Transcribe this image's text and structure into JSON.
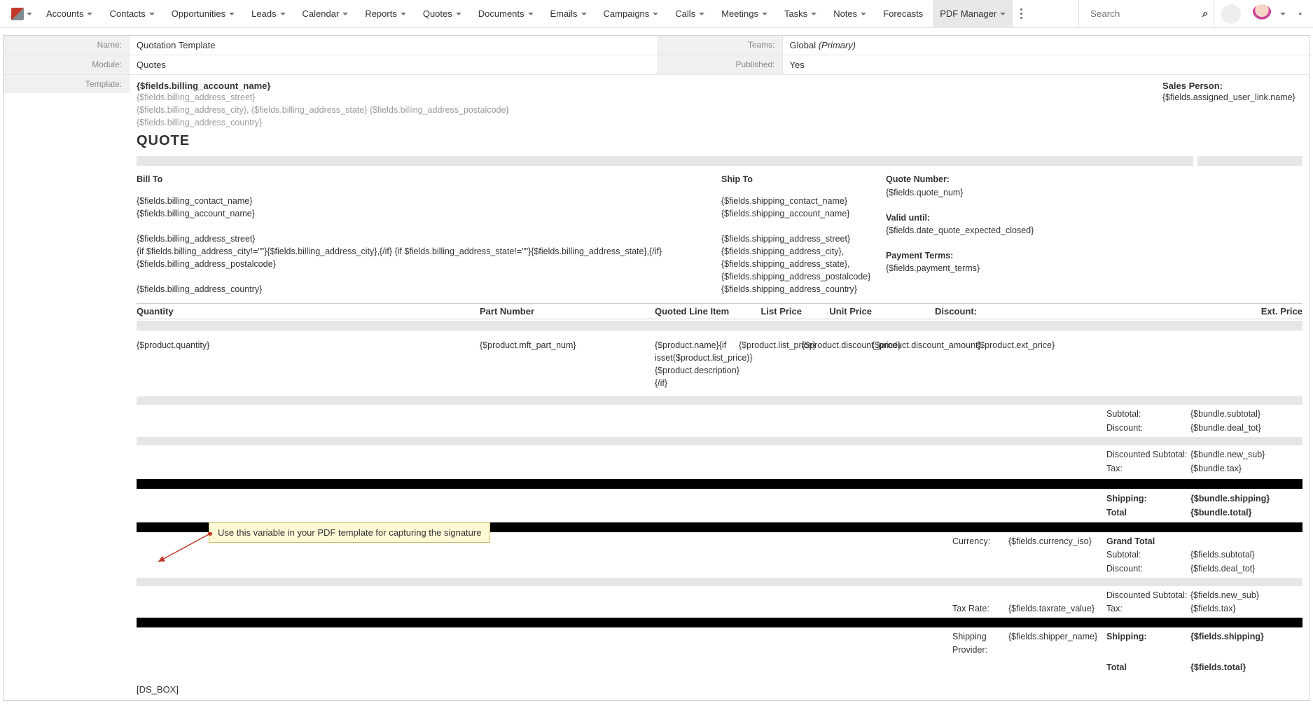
{
  "nav": {
    "items": [
      "Accounts",
      "Contacts",
      "Opportunities",
      "Leads",
      "Calendar",
      "Reports",
      "Quotes",
      "Documents",
      "Emails",
      "Campaigns",
      "Calls",
      "Meetings",
      "Tasks",
      "Notes",
      "Forecasts",
      "PDF Manager"
    ],
    "search_placeholder": "Search"
  },
  "record": {
    "labels": {
      "name": "Name:",
      "teams": "Teams:",
      "module": "Module:",
      "published": "Published:",
      "template": "Template:"
    },
    "name": "Quotation Template",
    "teams": "Global (Primary)",
    "teams_prefix": "Global ",
    "teams_suffix": "(Primary)",
    "module": "Quotes",
    "published": "Yes"
  },
  "template": {
    "billing_account": "{$fields.billing_account_name}",
    "addr_street": "{$fields.billing_address_street}",
    "addr_line2": "{$fields.billing_address_city}, {$fields.billing_address_state} {$fields.billing_address_postalcode}",
    "addr_country": "{$fields.billing_address_country}",
    "quote_heading": "QUOTE",
    "sales_person_label": "Sales Person:",
    "sales_person_value": "{$fields.assigned_user_link.name}",
    "bill_to": {
      "heading": "Bill To",
      "contact": "{$fields.billing_contact_name}",
      "account": "{$fields.billing_account_name}",
      "street": "{$fields.billing_address_street}",
      "citystate": "{if $fields.billing_address_city!=\"\"}{$fields.billing_address_city},{/if} {if $fields.billing_address_state!=\"\"}{$fields.billing_address_state},{/if} {$fields.billing_address_postalcode}",
      "country": "{$fields.billing_address_country}"
    },
    "ship_to": {
      "heading": "Ship To",
      "contact": "{$fields.shipping_contact_name}",
      "account": "{$fields.shipping_account_name}",
      "street": "{$fields.shipping_address_street}",
      "city": "{$fields.shipping_address_city},",
      "state": "{$fields.shipping_address_state},",
      "postal": "{$fields.shipping_address_postalcode}",
      "country": "{$fields.shipping_address_country}"
    },
    "right": {
      "qn_label": "Quote Number:",
      "qn_value": "{$fields.quote_num}",
      "valid_label": "Valid until:",
      "valid_value": "{$fields.date_quote_expected_closed}",
      "terms_label": "Payment Terms:",
      "terms_value": "{$fields.payment_terms}"
    },
    "table": {
      "headers": {
        "qty": "Quantity",
        "part": "Part Number",
        "qli": "Quoted Line Item",
        "list": "List Price",
        "unit": "Unit Price",
        "disc": "Discount:",
        "ext": "Ext. Price"
      },
      "row": {
        "qty": "{$product.quantity}",
        "part": "{$product.mft_part_num}",
        "qli": "{$product.name}{if isset($product.list_price)}{$product.description}{/if}",
        "list": "{$product.list_price}",
        "unit": "{$product.discount_price}",
        "disc": "{$product.discount_amount}",
        "ext": "{$product.ext_price}"
      }
    },
    "totals": {
      "subtotal_l": "Subtotal:",
      "subtotal_v": "{$bundle.subtotal}",
      "discount_l": "Discount:",
      "discount_v": "{$bundle.deal_tot}",
      "dsub_l": "Discounted Subtotal:",
      "dsub_v": "{$bundle.new_sub}",
      "tax_l": "Tax:",
      "tax_v": "{$bundle.tax}",
      "ship_l": "Shipping:",
      "ship_v": "{$bundle.shipping}",
      "total_l": "Total",
      "total_v": "{$bundle.total}",
      "currency_l": "Currency:",
      "currency_v": "{$fields.currency_iso}",
      "grand_l": "Grand Total",
      "g_sub_l": "Subtotal:",
      "g_sub_v": "{$fields.subtotal}",
      "g_disc_l": "Discount:",
      "g_disc_v": "{$fields.deal_tot}",
      "g_dsub_l": "Discounted Subtotal:",
      "g_dsub_v": "{$fields.new_sub}",
      "taxrate_l": "Tax Rate:",
      "taxrate_v": "{$fields.taxrate_value}",
      "g_tax_l": "Tax:",
      "g_tax_v": "{$fields.tax}",
      "shipprov_l": "Shipping Provider:",
      "shipprov_v": "{$fields.shipper_name}",
      "g_ship_l": "Shipping:",
      "g_ship_v": "{$fields.shipping}",
      "g_total_l": "Total",
      "g_total_v": "{$fields.total}"
    },
    "signature_var": "[DS_BOX]"
  },
  "tooltip": "Use this variable in your PDF template for capturing the signature"
}
